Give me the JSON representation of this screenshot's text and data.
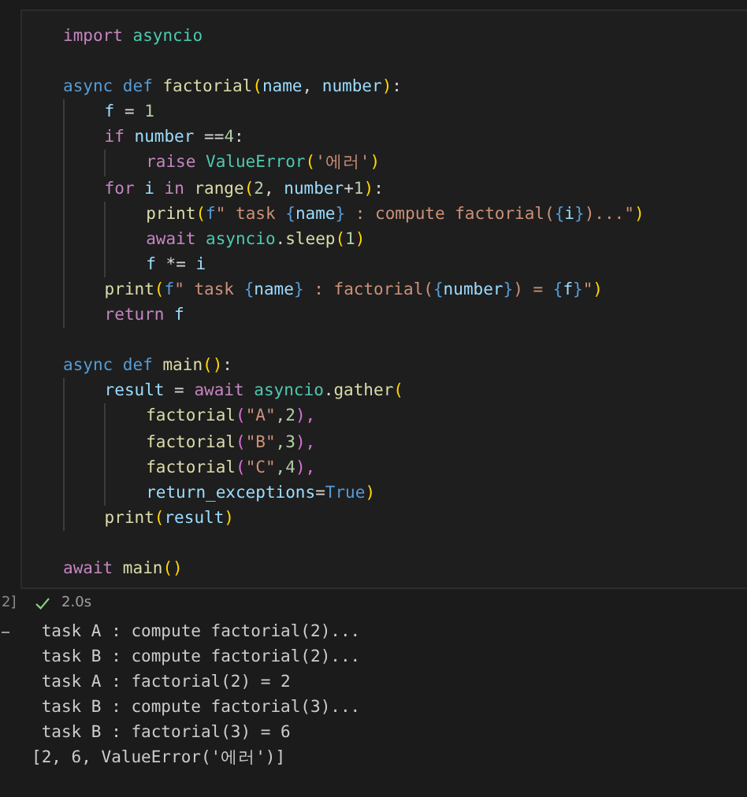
{
  "cell": {
    "lines": [
      {
        "kind": "code",
        "tokens": [
          {
            "text": "import",
            "kind": "kw"
          },
          {
            "text": " asyncio",
            "kind": "cls"
          }
        ]
      },
      {
        "kind": "blank"
      },
      {
        "kind": "code",
        "tokens": [
          {
            "text": "async",
            "kind": "storage"
          },
          {
            "text": " def",
            "kind": "storage"
          },
          {
            "text": " factorial",
            "kind": "fn"
          },
          {
            "text": "(",
            "kind": "b1"
          },
          {
            "text": "name",
            "kind": "var"
          },
          {
            "text": ",",
            "kind": "plain"
          },
          {
            "text": " number",
            "kind": "var"
          },
          {
            "text": ")",
            "kind": "b1"
          },
          {
            "text": ":",
            "kind": "plain"
          }
        ]
      },
      {
        "kind": "code",
        "tokens": [
          {
            "text": "    f",
            "kind": "var"
          },
          {
            "text": " = ",
            "kind": "plain"
          },
          {
            "text": "1",
            "kind": "num"
          }
        ]
      },
      {
        "kind": "code",
        "tokens": [
          {
            "text": "    if",
            "kind": "kw"
          },
          {
            "text": " number",
            "kind": "var"
          },
          {
            "text": " ==",
            "kind": "plain"
          },
          {
            "text": "4",
            "kind": "num"
          },
          {
            "text": ":",
            "kind": "plain"
          }
        ]
      },
      {
        "kind": "code",
        "tokens": [
          {
            "text": "        raise",
            "kind": "kw"
          },
          {
            "text": " ValueError",
            "kind": "cls"
          },
          {
            "text": "(",
            "kind": "b1"
          },
          {
            "text": "'에러'",
            "kind": "str"
          },
          {
            "text": ")",
            "kind": "b1"
          }
        ]
      },
      {
        "kind": "code",
        "tokens": [
          {
            "text": "    for",
            "kind": "kw"
          },
          {
            "text": " i",
            "kind": "var"
          },
          {
            "text": " in",
            "kind": "kw"
          },
          {
            "text": " range",
            "kind": "fn"
          },
          {
            "text": "(",
            "kind": "b1"
          },
          {
            "text": "2",
            "kind": "num"
          },
          {
            "text": ",",
            "kind": "plain"
          },
          {
            "text": " number",
            "kind": "var"
          },
          {
            "text": "+",
            "kind": "plain"
          },
          {
            "text": "1",
            "kind": "num"
          },
          {
            "text": ")",
            "kind": "b1"
          },
          {
            "text": ":",
            "kind": "plain"
          }
        ]
      },
      {
        "kind": "code",
        "tokens": [
          {
            "text": "        print",
            "kind": "fn"
          },
          {
            "text": "(",
            "kind": "b1"
          },
          {
            "text": "f",
            "kind": "storage"
          },
          {
            "text": "\" task ",
            "kind": "str"
          },
          {
            "text": "{",
            "kind": "storage"
          },
          {
            "text": "name",
            "kind": "var"
          },
          {
            "text": "}",
            "kind": "storage"
          },
          {
            "text": " : compute factorial(",
            "kind": "str"
          },
          {
            "text": "{",
            "kind": "storage"
          },
          {
            "text": "i",
            "kind": "var"
          },
          {
            "text": "}",
            "kind": "storage"
          },
          {
            "text": ")...\"",
            "kind": "str"
          },
          {
            "text": ")",
            "kind": "b1"
          }
        ]
      },
      {
        "kind": "code",
        "tokens": [
          {
            "text": "        await",
            "kind": "kw"
          },
          {
            "text": " asyncio",
            "kind": "cls"
          },
          {
            "text": ".",
            "kind": "plain"
          },
          {
            "text": "sleep",
            "kind": "fn"
          },
          {
            "text": "(",
            "kind": "b1"
          },
          {
            "text": "1",
            "kind": "num"
          },
          {
            "text": ")",
            "kind": "b1"
          }
        ]
      },
      {
        "kind": "code",
        "tokens": [
          {
            "text": "        f",
            "kind": "var"
          },
          {
            "text": " *= ",
            "kind": "plain"
          },
          {
            "text": "i",
            "kind": "var"
          }
        ]
      },
      {
        "kind": "code",
        "tokens": [
          {
            "text": "    print",
            "kind": "fn"
          },
          {
            "text": "(",
            "kind": "b1"
          },
          {
            "text": "f",
            "kind": "storage"
          },
          {
            "text": "\" task ",
            "kind": "str"
          },
          {
            "text": "{",
            "kind": "storage"
          },
          {
            "text": "name",
            "kind": "var"
          },
          {
            "text": "}",
            "kind": "storage"
          },
          {
            "text": " : factorial(",
            "kind": "str"
          },
          {
            "text": "{",
            "kind": "storage"
          },
          {
            "text": "number",
            "kind": "var"
          },
          {
            "text": "}",
            "kind": "storage"
          },
          {
            "text": ") = ",
            "kind": "str"
          },
          {
            "text": "{",
            "kind": "storage"
          },
          {
            "text": "f",
            "kind": "var"
          },
          {
            "text": "}",
            "kind": "storage"
          },
          {
            "text": "\"",
            "kind": "str"
          },
          {
            "text": ")",
            "kind": "b1"
          }
        ]
      },
      {
        "kind": "code",
        "tokens": [
          {
            "text": "    return",
            "kind": "kw"
          },
          {
            "text": " f",
            "kind": "var"
          }
        ]
      },
      {
        "kind": "blank"
      },
      {
        "kind": "code",
        "tokens": [
          {
            "text": "async",
            "kind": "storage"
          },
          {
            "text": " def",
            "kind": "storage"
          },
          {
            "text": " main",
            "kind": "fn"
          },
          {
            "text": "(",
            "kind": "b1"
          },
          {
            "text": ")",
            "kind": "b1"
          },
          {
            "text": ":",
            "kind": "plain"
          }
        ]
      },
      {
        "kind": "code",
        "tokens": [
          {
            "text": "    result",
            "kind": "var"
          },
          {
            "text": " = ",
            "kind": "plain"
          },
          {
            "text": "await",
            "kind": "kw"
          },
          {
            "text": " asyncio",
            "kind": "cls"
          },
          {
            "text": ".",
            "kind": "plain"
          },
          {
            "text": "gather",
            "kind": "fn"
          },
          {
            "text": "(",
            "kind": "b1"
          }
        ]
      },
      {
        "kind": "code",
        "tokens": [
          {
            "text": "        factorial",
            "kind": "fn"
          },
          {
            "text": "(",
            "kind": "b2"
          },
          {
            "text": "\"A\"",
            "kind": "str"
          },
          {
            "text": ",2",
            "kind": "num"
          },
          {
            "text": "),",
            "kind": "b2"
          }
        ]
      },
      {
        "kind": "code",
        "tokens": [
          {
            "text": "        factorial",
            "kind": "fn"
          },
          {
            "text": "(",
            "kind": "b2"
          },
          {
            "text": "\"B\"",
            "kind": "str"
          },
          {
            "text": ",3",
            "kind": "num"
          },
          {
            "text": "),",
            "kind": "b2"
          }
        ]
      },
      {
        "kind": "code",
        "tokens": [
          {
            "text": "        factorial",
            "kind": "fn"
          },
          {
            "text": "(",
            "kind": "b2"
          },
          {
            "text": "\"C\"",
            "kind": "str"
          },
          {
            "text": ",4",
            "kind": "num"
          },
          {
            "text": "),",
            "kind": "b2"
          }
        ]
      },
      {
        "kind": "code",
        "tokens": [
          {
            "text": "        return_exceptions",
            "kind": "var"
          },
          {
            "text": "=",
            "kind": "plain"
          },
          {
            "text": "True",
            "kind": "storage"
          },
          {
            "text": ")",
            "kind": "b1"
          }
        ]
      },
      {
        "kind": "code",
        "tokens": [
          {
            "text": "    print",
            "kind": "fn"
          },
          {
            "text": "(",
            "kind": "b1"
          },
          {
            "text": "result",
            "kind": "var"
          },
          {
            "text": ")",
            "kind": "b1"
          }
        ]
      },
      {
        "kind": "blank"
      },
      {
        "kind": "code",
        "tokens": [
          {
            "text": "await",
            "kind": "kw"
          },
          {
            "text": " main",
            "kind": "fn"
          },
          {
            "text": "(",
            "kind": "b1"
          },
          {
            "text": ")",
            "kind": "b1"
          }
        ]
      }
    ]
  },
  "status": {
    "execution_count": "2]",
    "succeeded": true,
    "duration": "2.0s"
  },
  "output": {
    "lines": [
      " task A : compute factorial(2)...",
      " task B : compute factorial(2)...",
      " task A : factorial(2) = 2",
      " task B : compute factorial(3)...",
      " task B : factorial(3) = 6",
      "[2, 6, ValueError('에러')]"
    ]
  }
}
